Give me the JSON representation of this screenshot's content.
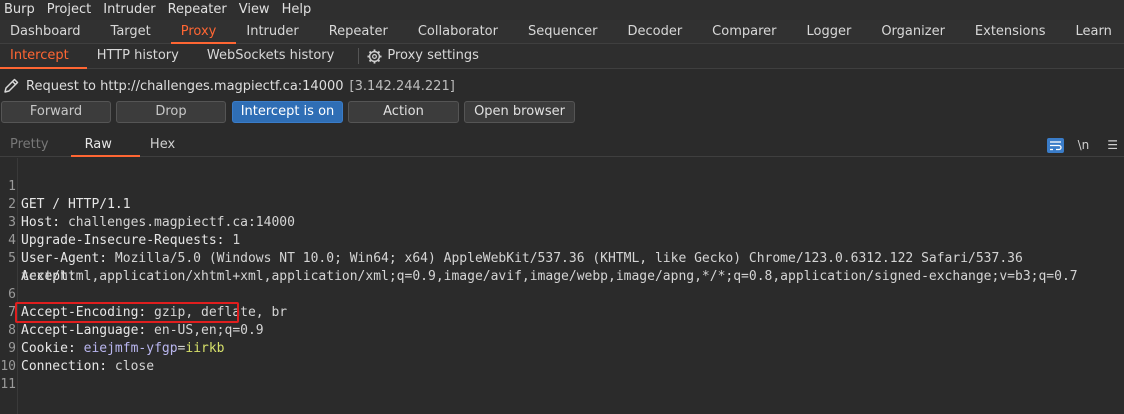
{
  "menu": [
    "Burp",
    "Project",
    "Intruder",
    "Repeater",
    "View",
    "Help"
  ],
  "main_tabs": [
    "Dashboard",
    "Target",
    "Proxy",
    "Intruder",
    "Repeater",
    "Collaborator",
    "Sequencer",
    "Decoder",
    "Comparer",
    "Logger",
    "Organizer",
    "Extensions",
    "Learn"
  ],
  "main_tab_active": "Proxy",
  "sub_tabs": {
    "intercept": "Intercept",
    "http_history": "HTTP history",
    "websockets_history": "WebSockets history",
    "proxy_settings": "Proxy settings"
  },
  "request": {
    "label": "Request to http://challenges.magpiectf.ca:14000",
    "ip": "[3.142.244.221]"
  },
  "buttons": {
    "forward": "Forward",
    "drop": "Drop",
    "intercept": "Intercept is on",
    "action": "Action",
    "open_browser": "Open browser"
  },
  "editor_tabs": {
    "pretty": "Pretty",
    "raw": "Raw",
    "hex": "Hex"
  },
  "editor_tools": {
    "newline": "\\n",
    "menu": "☰"
  },
  "lines": [
    {
      "n": "1",
      "key": "GET / HTTP/1.1",
      "val": ""
    },
    {
      "n": "2",
      "key": "Host:",
      "val": " challenges.magpiectf.ca:14000"
    },
    {
      "n": "3",
      "key": "Upgrade-Insecure-Requests:",
      "val": " 1"
    },
    {
      "n": "4",
      "key": "User-Agent:",
      "val": " Mozilla/5.0 (Windows NT 10.0; Win64; x64) AppleWebKit/537.36 (KHTML, like Gecko) Chrome/123.0.6312.122 Safari/537.36"
    },
    {
      "n": "5",
      "key": "Accept:",
      "val": ""
    },
    {
      "n": "",
      "key": "",
      "val": "text/html,application/xhtml+xml,application/xml;q=0.9,image/avif,image/webp,image/apng,*/*;q=0.8,application/signed-exchange;v=b3;q=0.7"
    },
    {
      "n": "6",
      "key": "Accept-Encoding:",
      "val": " gzip, deflate, br"
    },
    {
      "n": "7",
      "key": "Accept-Language:",
      "val": " en-US,en;q=0.9"
    },
    {
      "n": "8",
      "key": "Cookie:",
      "val": ""
    },
    {
      "n": "9",
      "key": "Connection:",
      "val": " close"
    },
    {
      "n": "10",
      "key": "",
      "val": ""
    },
    {
      "n": "11",
      "key": "",
      "val": ""
    }
  ],
  "cookie": {
    "name": "eiejmfm-yfgp",
    "eq": "=",
    "value": "iirkb"
  },
  "colors": {
    "accent": "#ff6633",
    "intercept_on": "#2f6eb5",
    "highlight_box": "#e01e1e",
    "cookie_value": "#d6e06a",
    "cookie_name": "#b9b6ef"
  }
}
